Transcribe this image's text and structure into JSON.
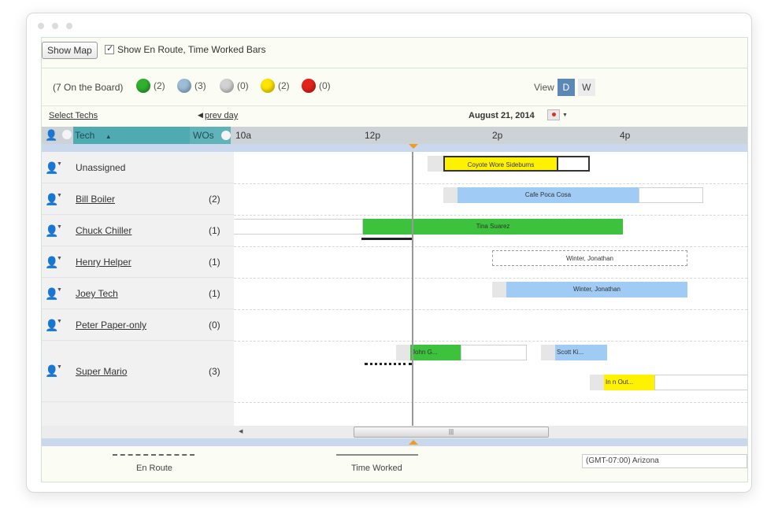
{
  "toolbar": {
    "show_map_label": "Show Map",
    "checkbox_label": "Show En Route, Time Worked Bars"
  },
  "legend": {
    "on_board": "(7 On the Board)",
    "statuses": [
      {
        "color": "#2fb12f",
        "count": "(2)"
      },
      {
        "color": "#9cbcd8",
        "count": "(3)"
      },
      {
        "color": "#d2d2d2",
        "count": "(0)"
      },
      {
        "color": "#ffe400",
        "count": "(2)"
      },
      {
        "color": "#e3231a",
        "count": "(0)"
      }
    ],
    "view_label": "View",
    "view_d": "D",
    "view_w": "W"
  },
  "nav": {
    "select_techs": "Select Techs",
    "prev_day": "prev day",
    "date": "August 21, 2014"
  },
  "header": {
    "tech": "Tech",
    "wos": "WOs",
    "ticks": [
      "10a",
      "12p",
      "2p",
      "4p"
    ]
  },
  "techs": [
    {
      "name": "Unassigned",
      "count": ""
    },
    {
      "name": "Bill Boiler",
      "count": "(2)"
    },
    {
      "name": "Chuck Chiller",
      "count": "(1)"
    },
    {
      "name": "Henry Helper",
      "count": "(1)"
    },
    {
      "name": "Joey Tech",
      "count": "(1)"
    },
    {
      "name": "Peter Paper-only",
      "count": "(0)"
    },
    {
      "name": "Super Mario",
      "count": "(3)"
    }
  ],
  "work_orders": {
    "coyote": "Coyote Wore Sideburns",
    "cafe": "Cafe Poca Cosa",
    "tina": "Tina Suarez",
    "winter1": "Winter, Jonathan",
    "winter2": "Winter, Jonathan",
    "john": "John G...",
    "scott": "Scott Ki...",
    "innout": "In n Out..."
  },
  "footer": {
    "en_route": "En Route",
    "time_worked": "Time Worked",
    "timezone": "(GMT-07:00) Arizona"
  }
}
